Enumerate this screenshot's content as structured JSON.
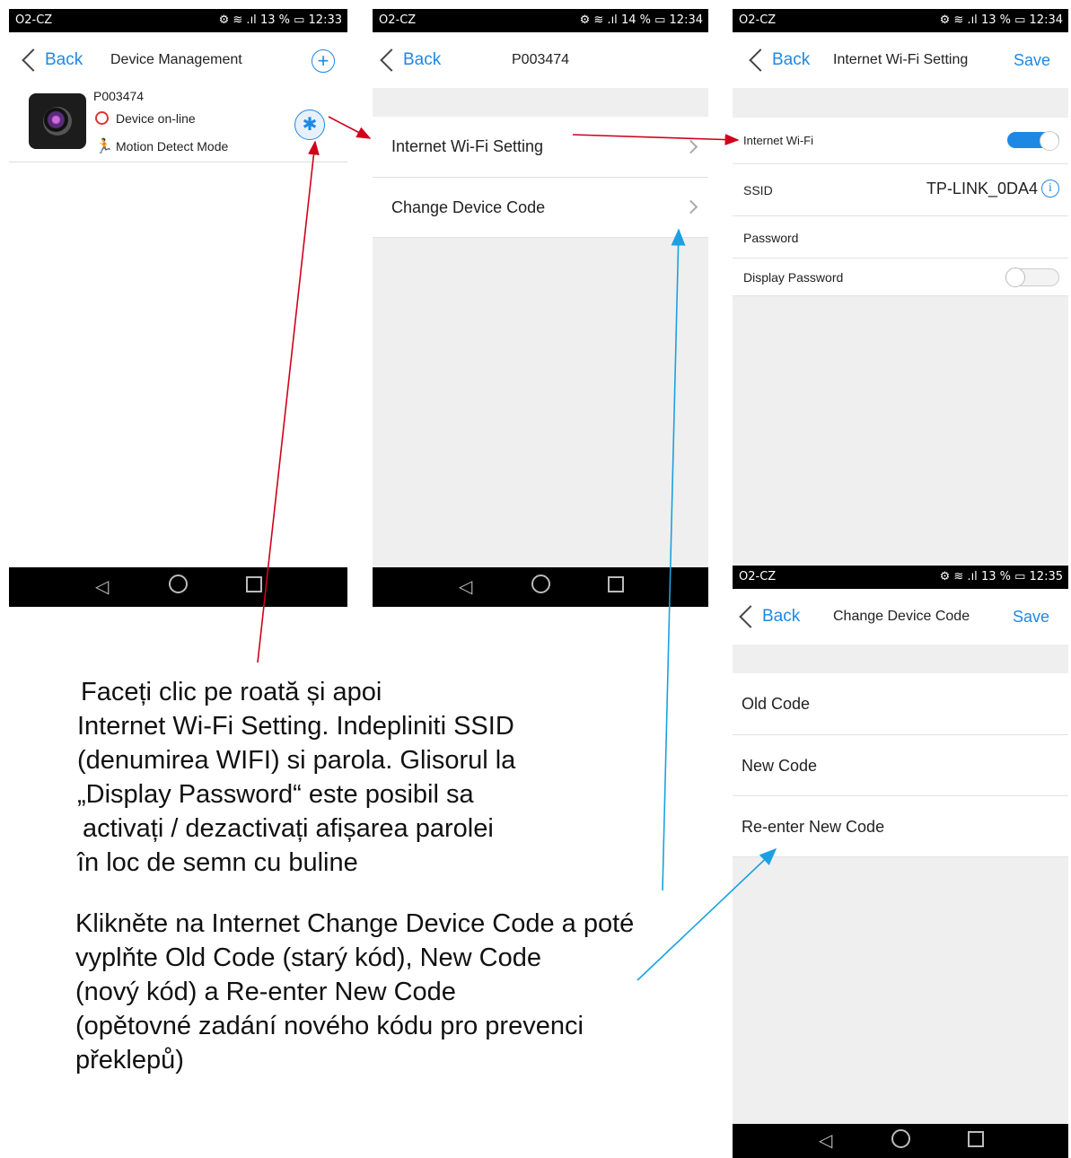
{
  "status": {
    "carrier": "O2-CZ",
    "s1": "13 %",
    "t1": "12:33",
    "s2": "14 %",
    "t2": "12:34",
    "s3": "13 %",
    "t3": "12:34",
    "s4": "13 %",
    "t4": "12:35"
  },
  "common": {
    "back": "Back",
    "save": "Save"
  },
  "screen1": {
    "title": "Device Management",
    "device_name": "P003474",
    "status_online": "Device on-line",
    "mode": "Motion Detect Mode"
  },
  "screen2": {
    "title": "P003474",
    "items": [
      "Internet Wi-Fi Setting",
      "Change Device Code"
    ]
  },
  "screen3": {
    "title": "Internet Wi-Fi Setting",
    "wifi_label": "Internet Wi-Fi",
    "ssid_label": "SSID",
    "ssid_value": "TP-LINK_0DA4",
    "password_label": "Password",
    "display_password_label": "Display Password"
  },
  "screen4": {
    "title": "Change Device Code",
    "fields": [
      "Old Code",
      "New Code",
      "Re-enter New Code"
    ]
  },
  "captions": {
    "ro": [
      "Faceți clic pe roată și apoi",
      "Internet Wi-Fi Setting. Indepliniti SSID",
      "(denumirea WIFI) si parola. Glisorul la",
      "„Display Password“ este posibil sa",
      "activați / dezactivați afișarea parolei",
      "în loc de semn cu buline"
    ],
    "cz": [
      "Klikněte na Internet Change Device Code a poté",
      "vyplňte Old Code (starý kód), New Code",
      "(nový kód) a Re-enter New Code",
      "(opětovné zadání nového kódu pro prevenci",
      "překlepů)"
    ]
  },
  "colors": {
    "accent": "#1e88e5",
    "arrow_red": "#d0021b",
    "arrow_blue": "#1ba1e2"
  }
}
